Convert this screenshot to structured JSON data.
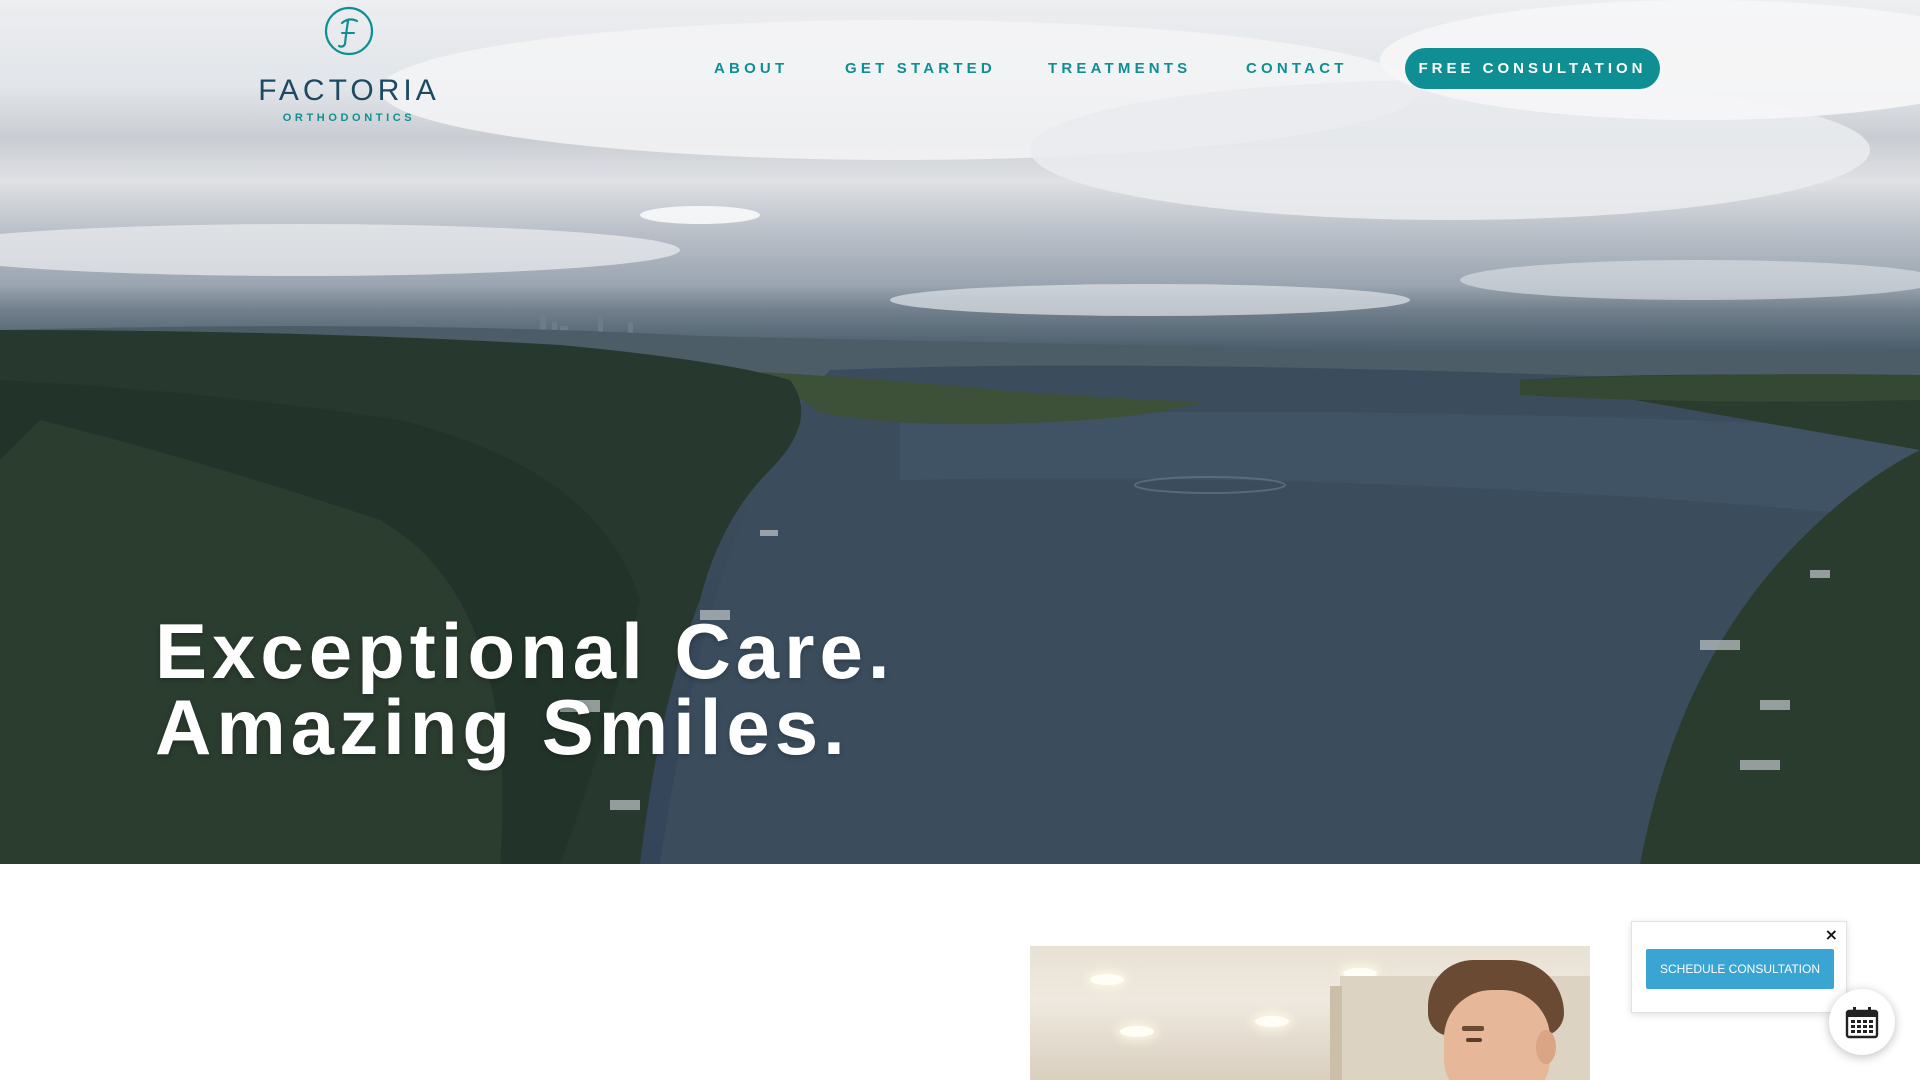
{
  "brand": {
    "name": "FACTORIA",
    "tagline": "ORTHODONTICS",
    "monogram": "F",
    "primary_color": "#0f8f93",
    "wordmark_color": "#1d4a63"
  },
  "nav": {
    "items": [
      {
        "label": "ABOUT"
      },
      {
        "label": "GET STARTED"
      },
      {
        "label": "TREATMENTS"
      },
      {
        "label": "CONTACT"
      }
    ],
    "cta_label": "FREE CONSULTATION"
  },
  "hero": {
    "headline_line1": "Exceptional Care.",
    "headline_line2": "Amazing Smiles."
  },
  "widget": {
    "button_label": "SCHEDULE CONSULTATION",
    "close_glyph": "×",
    "button_color": "#3aa4d2",
    "fab_icon": "calendar-icon"
  }
}
